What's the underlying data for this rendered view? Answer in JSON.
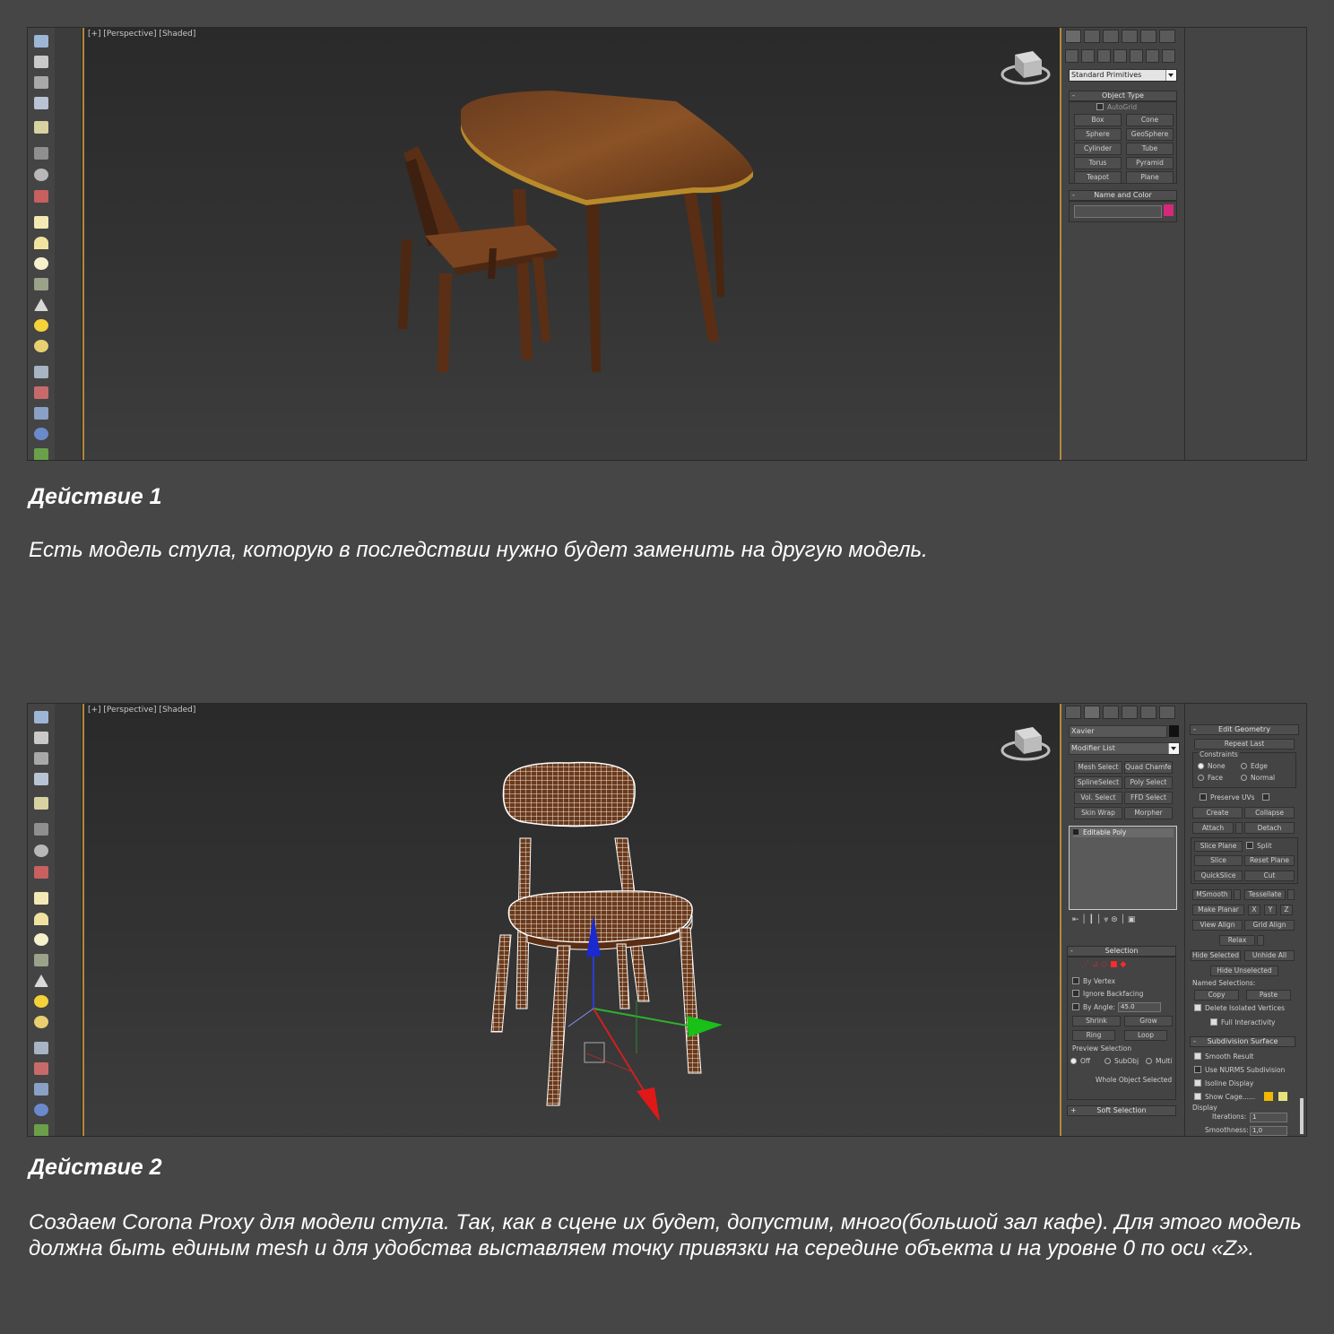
{
  "screenshot1": {
    "viewport_label": "[+] [Perspective] [Shaded]",
    "create_panel": {
      "category_dropdown": "Standard Primitives",
      "object_type_title": "Object Type",
      "autogrid_label": "AutoGrid",
      "primitives": [
        "Box",
        "Cone",
        "Sphere",
        "GeoSphere",
        "Cylinder",
        "Tube",
        "Torus",
        "Pyramid",
        "Teapot",
        "Plane"
      ],
      "name_color_title": "Name and Color",
      "color_swatch": "#d6287a"
    }
  },
  "caption1": {
    "heading": "Действие 1",
    "text": "Есть модель стула, которую в последствии нужно будет заменить на другую модель."
  },
  "screenshot2": {
    "viewport_label": "[+] [Perspective] [Shaded]",
    "modify_panel": {
      "object_name": "Xavier",
      "modifier_list_dropdown": "Modifier List",
      "modifier_buttons": [
        "Mesh Select",
        "Quad Chamfer",
        "SplineSelect",
        "Poly Select",
        "Vol. Select",
        "FFD Select",
        "Skin Wrap",
        "Morpher"
      ],
      "stack_item": "Editable Poly",
      "selection_title": "Selection",
      "by_vertex": "By Vertex",
      "ignore_backfacing": "Ignore Backfacing",
      "by_angle": "By Angle:",
      "by_angle_value": "45.0",
      "shrink": "Shrink",
      "grow": "Grow",
      "ring": "Ring",
      "loop": "Loop",
      "preview_selection": "Preview Selection",
      "preview_off": "Off",
      "preview_subobj": "SubObj",
      "preview_multi": "Multi",
      "whole_object_selected": "Whole Object Selected",
      "soft_selection_title": "Soft Selection"
    },
    "edit_geometry": {
      "title": "Edit Geometry",
      "repeat_last": "Repeat Last",
      "constraints": "Constraints",
      "none": "None",
      "edge": "Edge",
      "face": "Face",
      "normal": "Normal",
      "preserve_uvs": "Preserve UVs",
      "create": "Create",
      "collapse": "Collapse",
      "attach": "Attach",
      "detach": "Detach",
      "slice_plane": "Slice Plane",
      "split": "Split",
      "slice": "Slice",
      "reset_plane": "Reset Plane",
      "quickslice": "QuickSlice",
      "cut": "Cut",
      "msmooth": "MSmooth",
      "tessellate": "Tessellate",
      "make_planar": "Make Planar",
      "x": "X",
      "y": "Y",
      "z": "Z",
      "view_align": "View Align",
      "grid_align": "Grid Align",
      "relax": "Relax",
      "hide_selected": "Hide Selected",
      "unhide_all": "Unhide All",
      "hide_unselected": "Hide Unselected",
      "named_selections": "Named Selections:",
      "copy": "Copy",
      "paste": "Paste",
      "delete_isolated": "Delete Isolated Vertices",
      "full_interactivity": "Full Interactivity",
      "subdivision_title": "Subdivision Surface",
      "smooth_result": "Smooth Result",
      "use_nurms": "Use NURMS Subdivision",
      "isoline_display": "Isoline Display",
      "show_cage": "Show Cage......",
      "display": "Display",
      "iterations_label": "Iterations:",
      "iterations_value": "1",
      "smoothness_label": "Smoothness:",
      "smoothness_value": "1,0",
      "cage_colors": [
        "#f0b800",
        "#e8e27a"
      ]
    }
  },
  "caption2": {
    "heading": "Действие 2",
    "text": "Создаем Corona Proxy для модели стула. Так, как в сцене их будет, допустим, много(большой зал кафе). Для этого модель должна быть единым mesh и для удобства выставляем точку привязки на середине объекта и на уровне 0 по оси «Z»."
  },
  "colors": {
    "page_bg": "#464646",
    "active_viewport_border": "#b08a3a",
    "wood": "#6a3a1c"
  }
}
